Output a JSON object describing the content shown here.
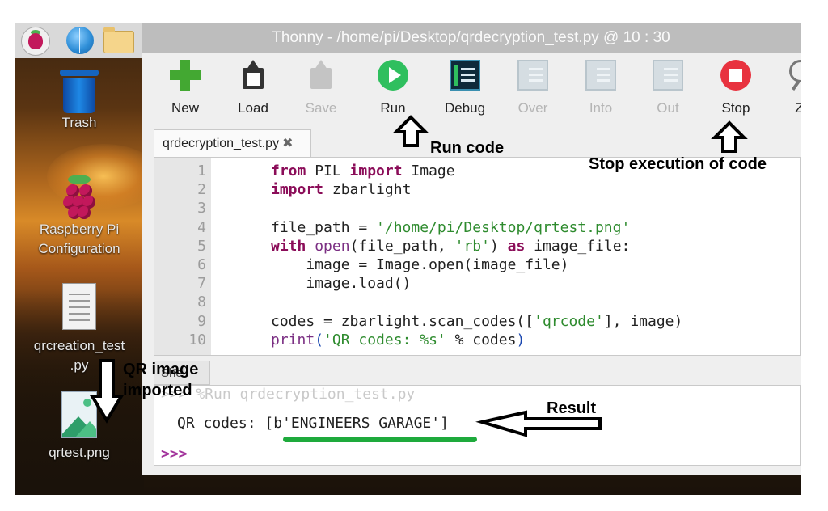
{
  "window": {
    "title": "Thonny  -  /home/pi/Desktop/qrdecryption_test.py  @  10 : 30"
  },
  "desktop": {
    "items": [
      {
        "label": "Trash"
      },
      {
        "label_line1": "Raspberry Pi",
        "label_line2": "Configuration"
      },
      {
        "label_line1": "qrcreation_test",
        "label_line2": ".py"
      },
      {
        "label": "qrtest.png"
      }
    ]
  },
  "toolbar": {
    "buttons": [
      {
        "label": "New",
        "icon": "new-icon",
        "enabled": true
      },
      {
        "label": "Load",
        "icon": "load-icon",
        "enabled": true
      },
      {
        "label": "Save",
        "icon": "save-icon",
        "enabled": false
      },
      {
        "label": "Run",
        "icon": "run-icon",
        "enabled": true
      },
      {
        "label": "Debug",
        "icon": "debug-icon",
        "enabled": true
      },
      {
        "label": "Over",
        "icon": "step-over-icon",
        "enabled": false
      },
      {
        "label": "Into",
        "icon": "step-into-icon",
        "enabled": false
      },
      {
        "label": "Out",
        "icon": "step-out-icon",
        "enabled": false
      },
      {
        "label": "Stop",
        "icon": "stop-icon",
        "enabled": true
      },
      {
        "label": "Zo",
        "icon": "zoom-icon",
        "enabled": true
      }
    ]
  },
  "editor": {
    "tab_label": "qrdecryption_test.py",
    "tab_close": "✖",
    "line_numbers": [
      "1",
      "2",
      "3",
      "4",
      "5",
      "6",
      "7",
      "8",
      "9",
      "10"
    ],
    "lines": [
      [
        {
          "t": "from",
          "c": "kw"
        },
        {
          "t": " PIL ",
          "c": ""
        },
        {
          "t": "import",
          "c": "kw"
        },
        {
          "t": " Image",
          "c": ""
        }
      ],
      [
        {
          "t": "import",
          "c": "kw"
        },
        {
          "t": " zbarlight",
          "c": ""
        }
      ],
      [],
      [
        {
          "t": "file_path = ",
          "c": ""
        },
        {
          "t": "'/home/pi/Desktop/qrtest.png'",
          "c": "st"
        }
      ],
      [
        {
          "t": "with",
          "c": "kw"
        },
        {
          "t": " ",
          "c": ""
        },
        {
          "t": "open",
          "c": "bi"
        },
        {
          "t": "(file_path, ",
          "c": ""
        },
        {
          "t": "'rb'",
          "c": "st"
        },
        {
          "t": ") ",
          "c": ""
        },
        {
          "t": "as",
          "c": "kw"
        },
        {
          "t": " image_file:",
          "c": ""
        }
      ],
      [
        {
          "t": "    image = Image.open(image_file)",
          "c": ""
        }
      ],
      [
        {
          "t": "    image.load()",
          "c": ""
        }
      ],
      [],
      [
        {
          "t": "codes = zbarlight.scan_codes([",
          "c": ""
        },
        {
          "t": "'qrcode'",
          "c": "st"
        },
        {
          "t": "], image)",
          "c": ""
        }
      ],
      [
        {
          "t": "print",
          "c": "bi"
        },
        {
          "t": "(",
          "c": "br"
        },
        {
          "t": "'QR codes: %s'",
          "c": "st"
        },
        {
          "t": " % codes",
          "c": ""
        },
        {
          "t": ")",
          "c": "br"
        }
      ]
    ]
  },
  "shell": {
    "tab_label": "Shell",
    "command": ">>> %Run qrdecryption_test.py",
    "output": "QR codes: [b'ENGINEERS GARAGE']",
    "prompt": ">>>"
  },
  "annotations": {
    "run_code": "Run code",
    "stop_execution": "Stop execution of code",
    "qr_image_line1": "QR image",
    "qr_image_line2": "imported",
    "result": "Result",
    "highlight_color": "#1eaa3c"
  }
}
